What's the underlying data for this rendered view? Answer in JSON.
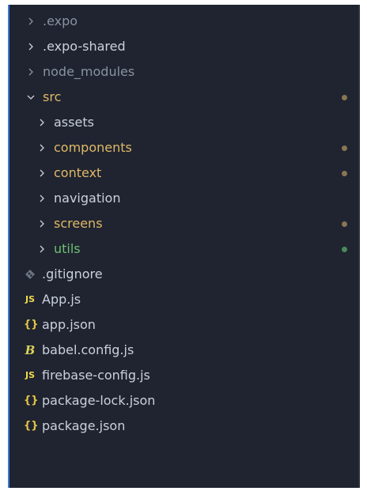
{
  "colors": {
    "panel_bg": "#1f2430",
    "text": "#cbd1dc",
    "dim_text": "#8a92a0",
    "modified": "#e0b867",
    "untracked": "#6fbf73",
    "dot_modified": "#8a7553",
    "dot_untracked": "#4a8a5a",
    "js_badge": "#f1d94b",
    "json_badge": "#e7c547",
    "git_icon": "#6b7280",
    "babel_icon": "#d9d25a"
  },
  "tree": {
    "items": [
      {
        "label": ".expo",
        "kind": "folder",
        "expanded": false,
        "icon": "chevron-right-icon"
      },
      {
        "label": ".expo-shared",
        "kind": "folder",
        "expanded": false,
        "icon": "chevron-right-icon"
      },
      {
        "label": "node_modules",
        "kind": "folder",
        "expanded": false,
        "icon": "chevron-right-icon"
      },
      {
        "label": "src",
        "kind": "folder",
        "expanded": true,
        "icon": "chevron-down-icon"
      },
      {
        "label": "assets",
        "kind": "folder",
        "expanded": false,
        "icon": "chevron-right-icon"
      },
      {
        "label": "components",
        "kind": "folder",
        "expanded": false,
        "icon": "chevron-right-icon"
      },
      {
        "label": "context",
        "kind": "folder",
        "expanded": false,
        "icon": "chevron-right-icon"
      },
      {
        "label": "navigation",
        "kind": "folder",
        "expanded": false,
        "icon": "chevron-right-icon"
      },
      {
        "label": "screens",
        "kind": "folder",
        "expanded": false,
        "icon": "chevron-right-icon"
      },
      {
        "label": "utils",
        "kind": "folder",
        "expanded": false,
        "icon": "chevron-right-icon"
      },
      {
        "label": ".gitignore",
        "kind": "file",
        "icon": "git-diamond-icon"
      },
      {
        "label": "App.js",
        "kind": "file",
        "icon": "js-file-icon",
        "badge": "JS"
      },
      {
        "label": "app.json",
        "kind": "file",
        "icon": "json-file-icon",
        "badge": "{}"
      },
      {
        "label": "babel.config.js",
        "kind": "file",
        "icon": "babel-file-icon",
        "badge": "B"
      },
      {
        "label": "firebase-config.js",
        "kind": "file",
        "icon": "js-file-icon",
        "badge": "JS"
      },
      {
        "label": "package-lock.json",
        "kind": "file",
        "icon": "json-file-icon",
        "badge": "{}"
      },
      {
        "label": "package.json",
        "kind": "file",
        "icon": "json-file-icon",
        "badge": "{}"
      }
    ]
  }
}
